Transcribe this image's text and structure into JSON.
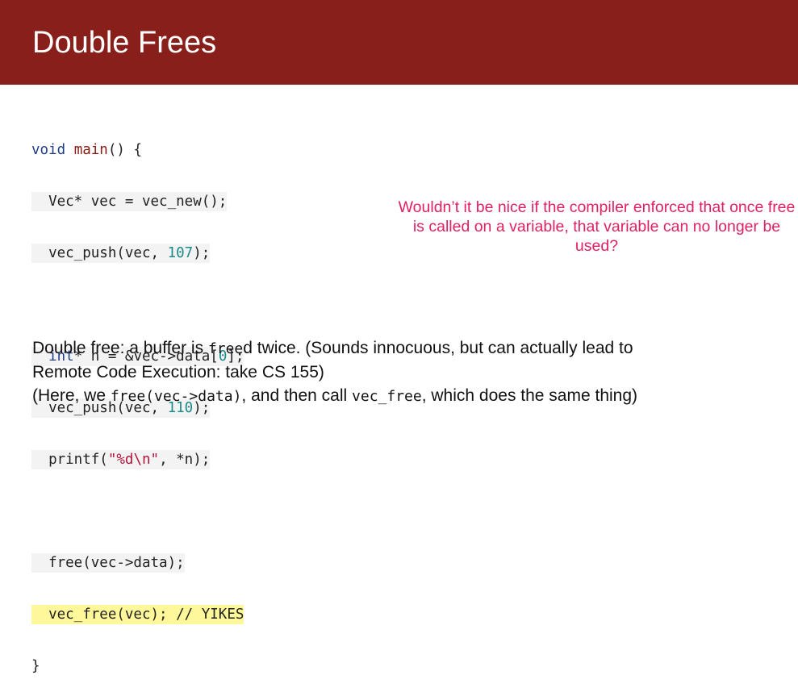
{
  "slide": {
    "title": "Double Frees"
  },
  "code": {
    "l1_kw": "void",
    "l1_fn": "main",
    "l1_rest": "() {",
    "l2": "Vec* vec = vec_new();",
    "l3_a": "vec_push(vec, ",
    "l3_num": "107",
    "l3_b": ");",
    "l5_kw": "int",
    "l5_a": "* n = &vec->data[",
    "l5_num": "0",
    "l5_b": "];",
    "l6_a": "vec_push(vec, ",
    "l6_num": "110",
    "l6_b": ");",
    "l7_a": "printf(",
    "l7_str": "\"%d\\n\"",
    "l7_b": ", *n);",
    "l9": "free(vec->data);",
    "l10": "vec_free(vec); // YIKES",
    "l11": "}"
  },
  "callout": {
    "text": "Wouldn’t it be nice if the compiler enforced that once free is called on a variable, that variable can no longer be used?"
  },
  "description": {
    "p1_a": "Double free: a buffer is ",
    "p1_code": "free",
    "p1_b": "d twice. (Sounds innocuous, but can actually lead to",
    "p2": "Remote Code Execution: take CS 155)",
    "p3_a": "(Here, we ",
    "p3_code1": "free(vec->data)",
    "p3_b": ", and then call ",
    "p3_code2": "vec_free",
    "p3_c": ", which does the same thing)"
  },
  "colors": {
    "header_bg": "#891f1a",
    "callout_text": "#e0215f",
    "highlight": "#fff89a"
  }
}
